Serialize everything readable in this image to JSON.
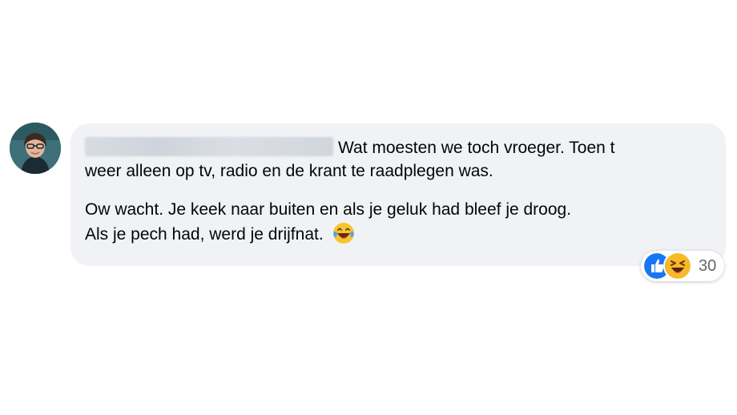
{
  "comment": {
    "text_line1": "Wat moesten we toch vroeger. Toen t",
    "text_line2": "weer alleen op tv, radio en de krant te raadplegen was.",
    "text_line3": "Ow wacht. Je keek naar buiten en als je geluk had bleef je droog.",
    "text_line4": "Als je pech had, werd je drijfnat."
  },
  "reactions": {
    "count": "30",
    "icons": [
      "like-icon",
      "haha-icon"
    ]
  },
  "colors": {
    "bubble": "#f0f2f5",
    "like_blue": "#1877f2",
    "haha_yellow": "#f7b928",
    "count_gray": "#65676b"
  }
}
